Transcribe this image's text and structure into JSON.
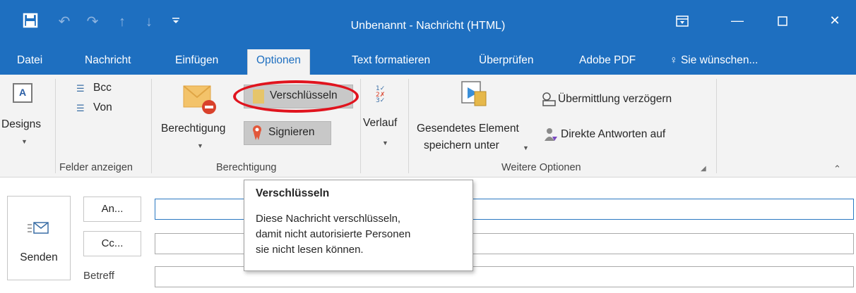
{
  "window": {
    "title": "Unbenannt - Nachricht (HTML)",
    "accent_color": "#1e6fc0"
  },
  "quick_access": {
    "icons": [
      "save-icon",
      "undo-icon",
      "redo-icon",
      "up-arrow-icon",
      "down-arrow-icon",
      "customize-icon"
    ]
  },
  "window_controls": {
    "icons": [
      "ribbon-display-icon",
      "minimize-icon",
      "maximize-icon",
      "close-icon"
    ]
  },
  "tabs": [
    {
      "label": "Datei"
    },
    {
      "label": "Nachricht"
    },
    {
      "label": "Einfügen"
    },
    {
      "label": "Optionen",
      "active": true
    },
    {
      "label": "Text formatieren"
    },
    {
      "label": "Überprüfen"
    },
    {
      "label": "Adobe PDF"
    },
    {
      "label": "Sie wünschen..."
    }
  ],
  "ribbon": {
    "designs": {
      "label": "Designs"
    },
    "felder": {
      "bcc": "Bcc",
      "von": "Von",
      "group_label": "Felder anzeigen"
    },
    "berechtigung": {
      "berechtigung_label": "Berechtigung",
      "verschluesseln": "Verschlüsseln",
      "signieren": "Signieren",
      "group_label": "Berechtigung"
    },
    "verlauf": {
      "label": "Verlauf"
    },
    "weitere": {
      "gesendetes_line1": "Gesendetes Element",
      "gesendetes_line2": "speichern unter",
      "uebermittlung": "Übermittlung verzögern",
      "direkte": "Direkte Antworten auf",
      "group_label": "Weitere Optionen"
    }
  },
  "compose": {
    "send_label": "Senden",
    "to_label": "An...",
    "cc_label": "Cc...",
    "subject_label": "Betreff",
    "to_value": "",
    "cc_value": "",
    "subject_value": ""
  },
  "tooltip": {
    "title": "Verschlüsseln",
    "lines": [
      "Diese Nachricht verschlüsseln,",
      "damit nicht autorisierte Personen",
      "sie nicht lesen können."
    ]
  }
}
